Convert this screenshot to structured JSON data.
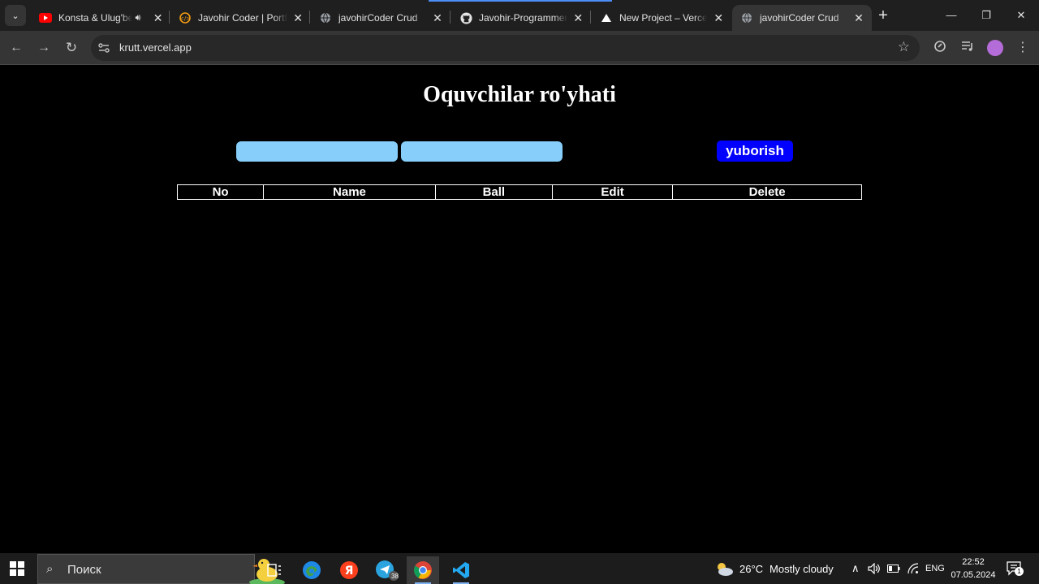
{
  "browser": {
    "tabs": [
      {
        "title": "Konsta & Ulug'bek",
        "favicon": "youtube-icon",
        "audio": true
      },
      {
        "title": "Javohir Coder | Portfolio",
        "favicon": "portfolio-icon"
      },
      {
        "title": "javohirCoder Crud",
        "favicon": "globe-icon"
      },
      {
        "title": "Javohir-Programmer/",
        "favicon": "github-icon"
      },
      {
        "title": "New Project – Vercel",
        "favicon": "vercel-icon"
      },
      {
        "title": "javohirCoder Crud",
        "favicon": "globe-icon",
        "active": true
      }
    ],
    "url": "krutt.vercel.app"
  },
  "page": {
    "title": "Oquvchilar ro'yhati",
    "inputs": [
      {
        "value": "",
        "placeholder": ""
      },
      {
        "value": "",
        "placeholder": ""
      }
    ],
    "submit_label": "yuborish",
    "table": {
      "headers": [
        "No",
        "Name",
        "Ball",
        "Edit",
        "Delete"
      ],
      "rows": []
    }
  },
  "taskbar": {
    "search_placeholder": "Поиск",
    "telegram_badge": "38",
    "weather": {
      "temp": "26°C",
      "condition": "Mostly cloudy"
    },
    "language": "ENG",
    "time": "22:52",
    "date": "07.05.2024",
    "notifications": "1"
  },
  "colors": {
    "input_bg": "#87cefa",
    "button_bg": "#0000ff",
    "page_bg": "#000000"
  }
}
